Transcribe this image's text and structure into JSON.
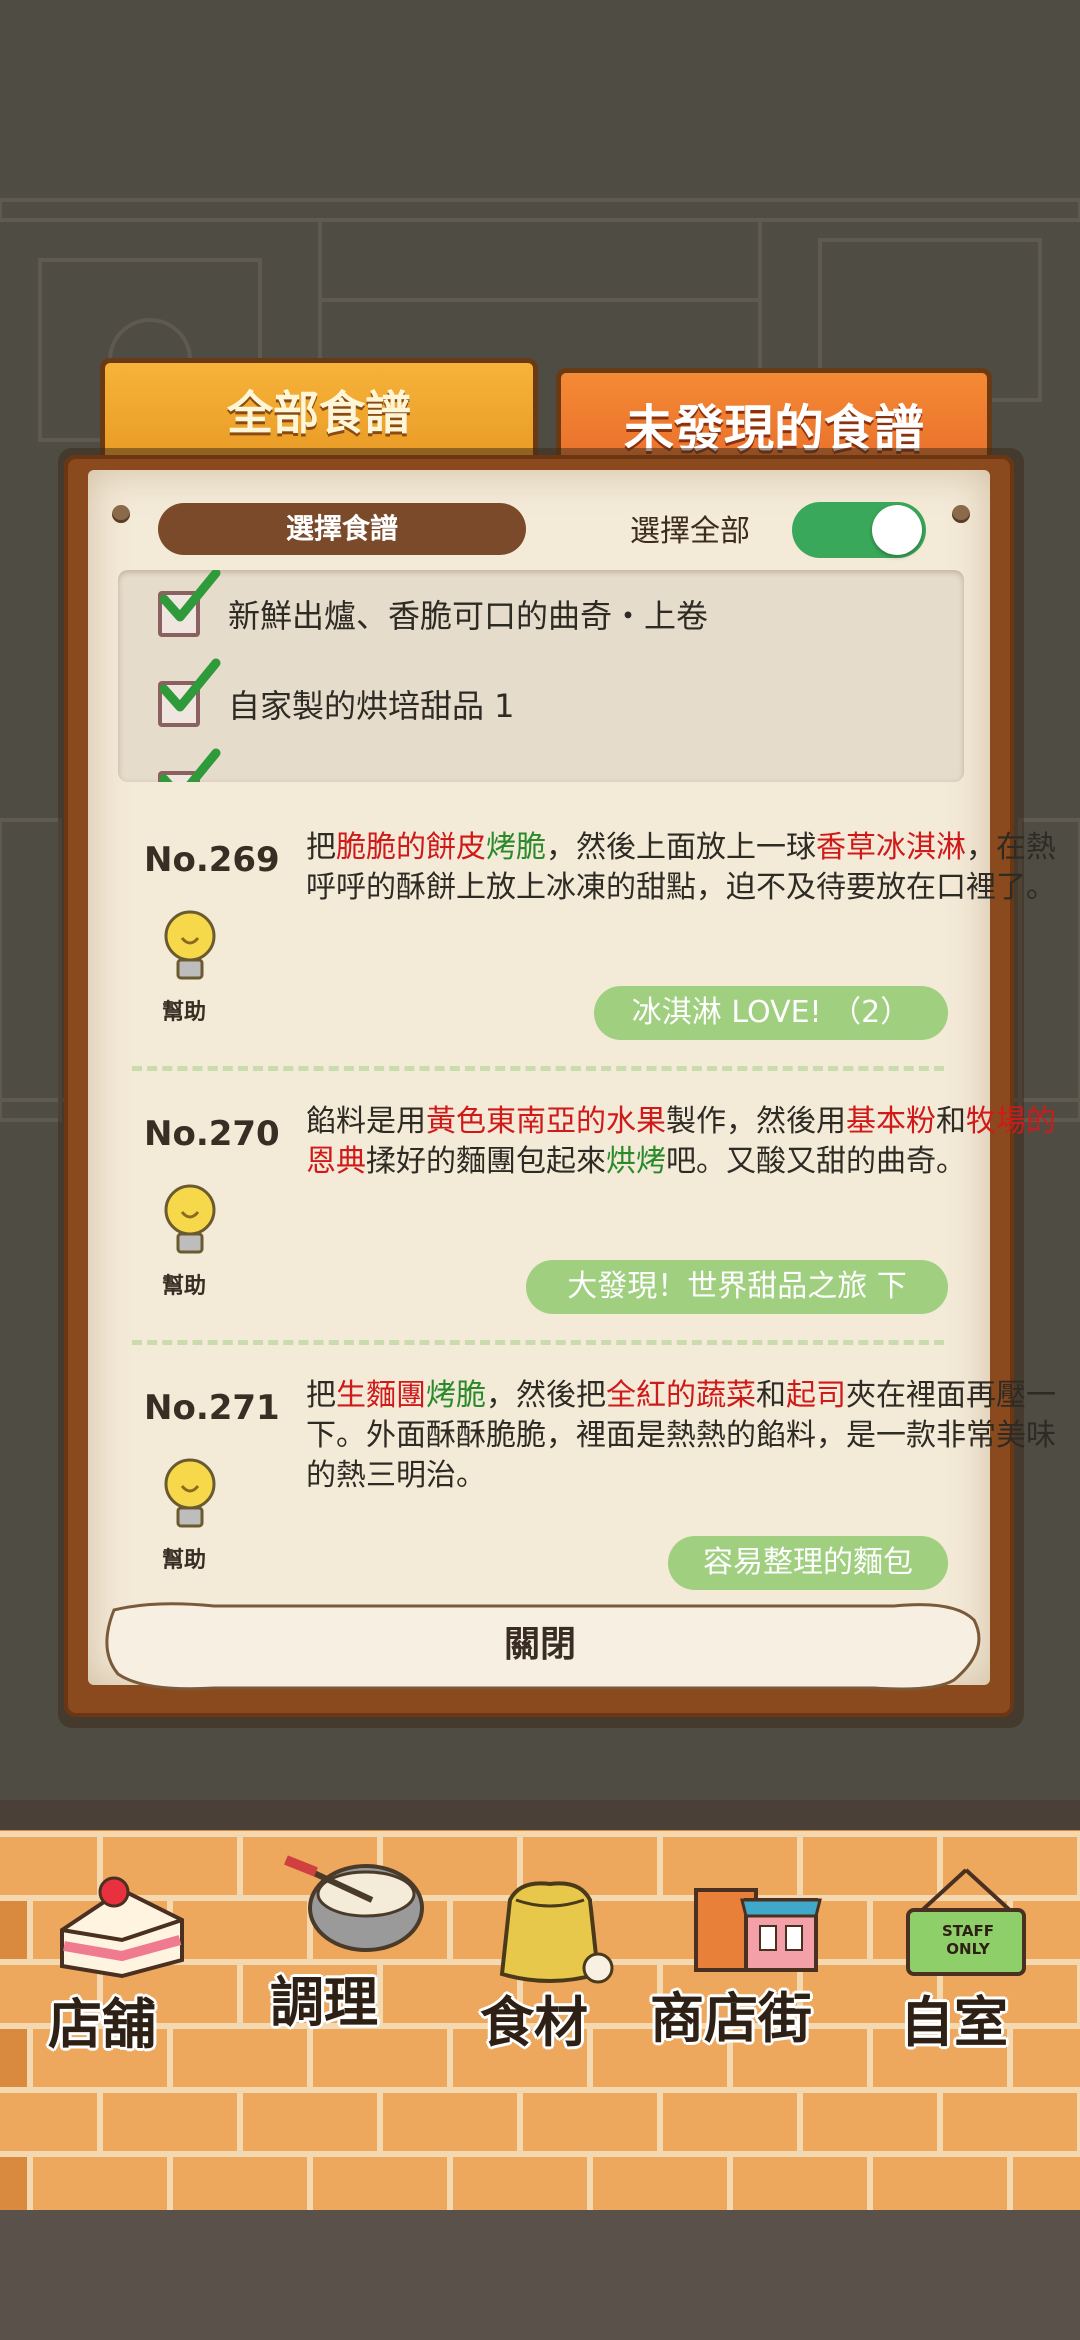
{
  "tabs": {
    "all_recipes": "全部食譜",
    "undiscovered_recipes": "未發現的食譜"
  },
  "filter": {
    "select_recipes_label": "選擇食譜",
    "select_all_label": "選擇全部",
    "select_all_on": true,
    "books": [
      {
        "label": "新鮮出爐、香脆可口的曲奇・上卷",
        "checked": true
      },
      {
        "label": "自家製的烘培甜品 1",
        "checked": true
      }
    ]
  },
  "entries": [
    {
      "number": "No.269",
      "help_label": "幫助",
      "desc": [
        {
          "t": "把",
          "c": ""
        },
        {
          "t": "脆脆的餅皮",
          "c": "r"
        },
        {
          "t": "烤脆",
          "c": "g"
        },
        {
          "t": "，然後上面放上一球",
          "c": ""
        },
        {
          "t": "香草冰淇淋",
          "c": "r"
        },
        {
          "t": "，在熱呼呼的酥餅上放上冰凍的甜點，迫不及待要放在口裡了。",
          "c": ""
        }
      ],
      "book": "冰淇淋 LOVE! （2）"
    },
    {
      "number": "No.270",
      "help_label": "幫助",
      "desc": [
        {
          "t": "餡料是用",
          "c": ""
        },
        {
          "t": "黃色東南亞的水果",
          "c": "r"
        },
        {
          "t": "製作，然後用",
          "c": ""
        },
        {
          "t": "基本粉",
          "c": "r"
        },
        {
          "t": "和",
          "c": ""
        },
        {
          "t": "牧場的恩典",
          "c": "r"
        },
        {
          "t": "揉好的麵團包起來",
          "c": ""
        },
        {
          "t": "烘烤",
          "c": "g"
        },
        {
          "t": "吧。又酸又甜的曲奇。",
          "c": ""
        }
      ],
      "book": "大發現！世界甜品之旅 下"
    },
    {
      "number": "No.271",
      "help_label": "幫助",
      "desc": [
        {
          "t": "把",
          "c": ""
        },
        {
          "t": "生麵團",
          "c": "r"
        },
        {
          "t": "烤脆",
          "c": "g"
        },
        {
          "t": "，然後把",
          "c": ""
        },
        {
          "t": "全紅的蔬菜",
          "c": "r"
        },
        {
          "t": "和",
          "c": ""
        },
        {
          "t": "起司",
          "c": "r"
        },
        {
          "t": "夾在裡面再壓一下。外面酥酥脆脆，裡面是熱熱的餡料，是一款非常美味的熱三明治。",
          "c": ""
        }
      ],
      "book": "容易整理的麵包"
    }
  ],
  "close_label": "關閉",
  "nav": {
    "shop": "店舖",
    "cook": "調理",
    "ingredients": "食材",
    "shopping_street": "商店街",
    "my_room": "自室",
    "staff_sign": "STAFF ONLY"
  },
  "colors": {
    "highlight_red": "#d01a1a",
    "highlight_green": "#2a8a2a",
    "book_badge": "#9fcf7f",
    "toggle_on": "#3aa85a"
  }
}
